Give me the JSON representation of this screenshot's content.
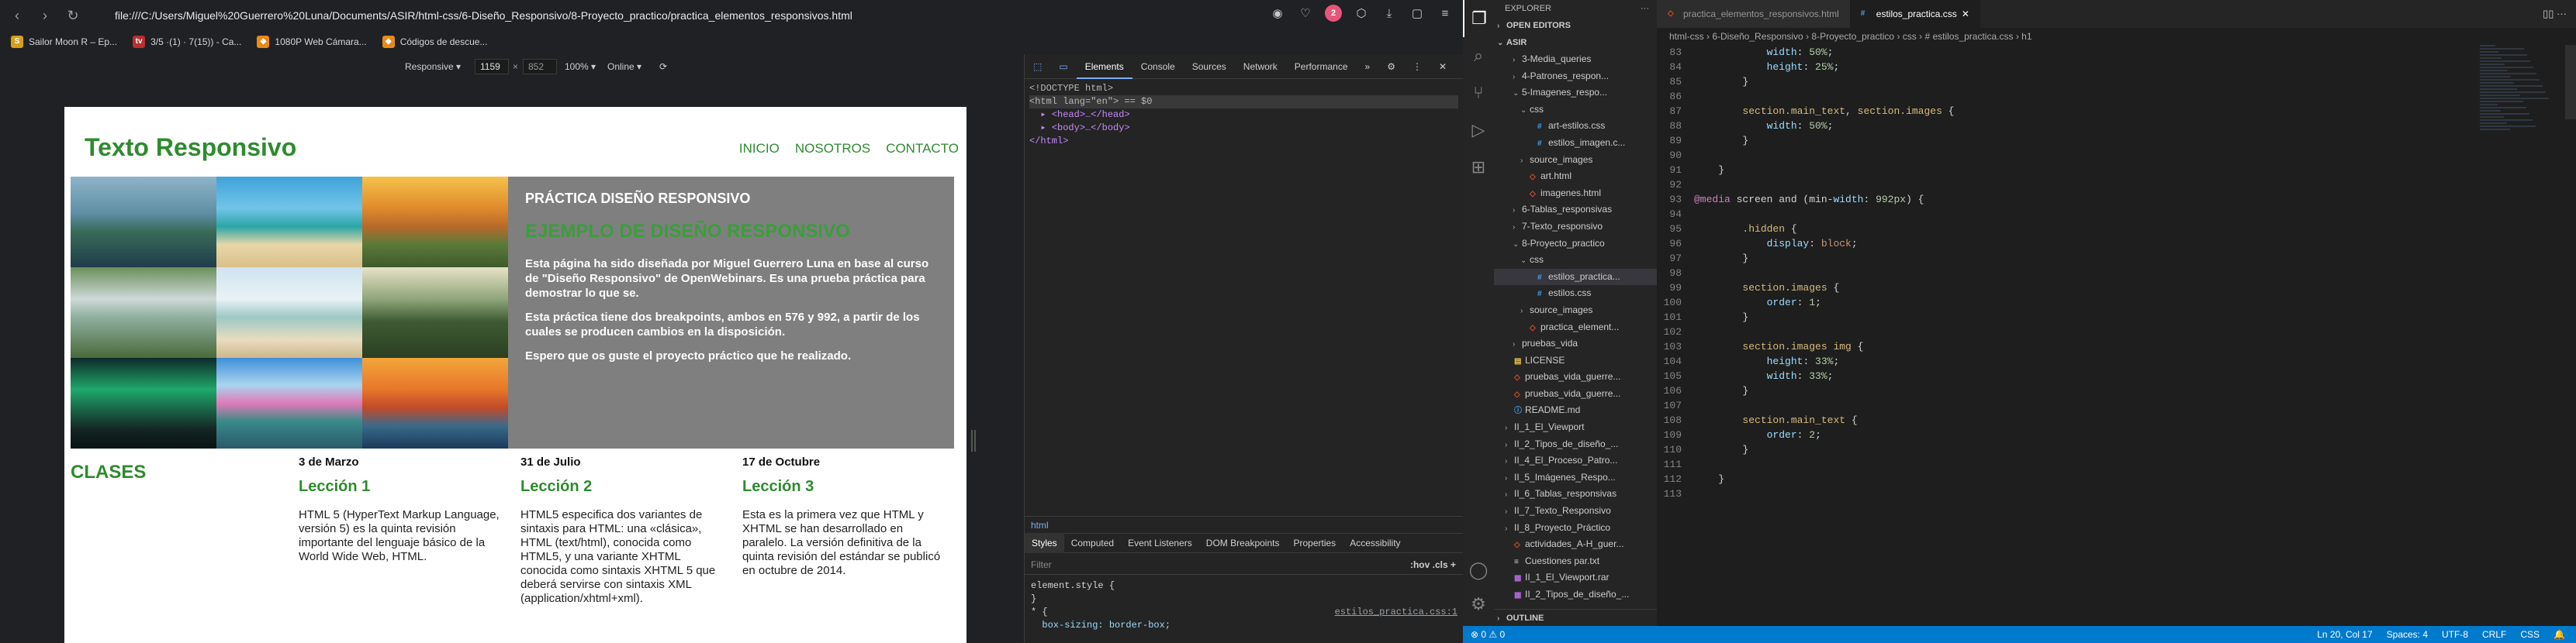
{
  "browser": {
    "url": "file:///C:/Users/Miguel%20Guerrero%20Luna/Documents/ASIR/html-css/6-Diseño_Responsivo/8-Proyecto_practico/practica_elementos_responsivos.html",
    "bookmarks": [
      {
        "label": "Sailor Moon R – Ep...",
        "color": "#d4a017",
        "icon": "S"
      },
      {
        "label": "3/5 ·(1) · 7(15)) - Ca...",
        "color": "#b83030",
        "icon": "tv"
      },
      {
        "label": "1080P Web Cámara...",
        "color": "#e88a1a",
        "icon": "◆"
      },
      {
        "label": "Códigos de descue...",
        "color": "#e88a1a",
        "icon": "◆"
      }
    ],
    "profile_badge": "2",
    "device_toolbar": {
      "device": "Responsive ▾",
      "width": "1159",
      "times": "×",
      "height": "852",
      "zoom": "100% ▾",
      "throttle": "Online ▾"
    }
  },
  "site": {
    "title": "Texto Responsivo",
    "nav": [
      "INICIO",
      "NOSOTROS",
      "CONTACTO"
    ],
    "main_heading": "PRÁCTICA DISEÑO RESPONSIVO",
    "subheading": "EJEMPLO DE DISEÑO RESPONSIVO",
    "paragraphs": [
      "Esta página ha sido diseñada por Miguel Guerrero Luna en base al curso de \"Diseño Responsivo\" de OpenWebinars. Es una prueba práctica para demostrar lo que se.",
      "Esta práctica tiene dos breakpoints, ambos en 576 y 992, a partir de los cuales se producen cambios en la disposición.",
      "Espero que os guste el proyecto práctico que he realizado."
    ],
    "classes_title": "CLASES",
    "classes": [
      {
        "date": "3 de Marzo",
        "title": "Lección 1",
        "text": "HTML 5 (HyperText Markup Language, versión 5) es la quinta revisión importante del lenguaje básico de la World Wide Web, HTML."
      },
      {
        "date": "31 de Julio",
        "title": "Lección 2",
        "text": "HTML5 especifica dos variantes de sintaxis para HTML: una «clásica», HTML (text/html), conocida como HTML5, y una variante XHTML conocida como sintaxis XHTML 5 que deberá servirse con sintaxis XML (application/xhtml+xml)."
      },
      {
        "date": "17 de Octubre",
        "title": "Lección 3",
        "text": "Esta es la primera vez que HTML y XHTML se han desarrollado en paralelo. La versión definitiva de la quinta revisión del estándar se publicó en octubre de 2014."
      }
    ]
  },
  "devtools": {
    "tabs": [
      "Elements",
      "Console",
      "Sources",
      "Network",
      "Performance",
      "»"
    ],
    "dom": [
      "<!DOCTYPE html>",
      "<html lang=\"en\"> == $0",
      "  ▸ <head>…</head>",
      "  ▸ <body>…</body>",
      "</html>"
    ],
    "breadcrumb": "html",
    "styles_tabs": [
      "Styles",
      "Computed",
      "Event Listeners",
      "DOM Breakpoints",
      "Properties",
      "Accessibility"
    ],
    "filter_placeholder": "Filter",
    "filter_actions": ":hov  .cls  +",
    "styles_lines": [
      "element.style {",
      "}",
      "* {",
      "  box-sizing: border-box;"
    ],
    "styles_source": "estilos_practica.css:1"
  },
  "vscode": {
    "explorer_title": "EXPLORER",
    "open_editors": "OPEN EDITORS",
    "root": "ASIR",
    "tree": [
      {
        "name": "3-Media_queries",
        "type": "folder",
        "depth": 2,
        "open": false
      },
      {
        "name": "4-Patrones_respon...",
        "type": "folder",
        "depth": 2,
        "open": false
      },
      {
        "name": "5-Imagenes_respo...",
        "type": "folder",
        "depth": 2,
        "open": true
      },
      {
        "name": "css",
        "type": "folder",
        "depth": 3,
        "open": true
      },
      {
        "name": "art-estilos.css",
        "type": "css",
        "depth": 4
      },
      {
        "name": "estilos_imagen.c...",
        "type": "css",
        "depth": 4
      },
      {
        "name": "source_images",
        "type": "folder",
        "depth": 3,
        "open": false
      },
      {
        "name": "art.html",
        "type": "html",
        "depth": 3
      },
      {
        "name": "imagenes.html",
        "type": "html",
        "depth": 3
      },
      {
        "name": "6-Tablas_responsivas",
        "type": "folder",
        "depth": 2,
        "open": false
      },
      {
        "name": "7-Texto_responsivo",
        "type": "folder",
        "depth": 2,
        "open": false
      },
      {
        "name": "8-Proyecto_practico",
        "type": "folder",
        "depth": 2,
        "open": true
      },
      {
        "name": "css",
        "type": "folder",
        "depth": 3,
        "open": true
      },
      {
        "name": "estilos_practica...",
        "type": "css",
        "depth": 4,
        "selected": true
      },
      {
        "name": "estilos.css",
        "type": "css",
        "depth": 4
      },
      {
        "name": "source_images",
        "type": "folder",
        "depth": 3,
        "open": false
      },
      {
        "name": "practica_element...",
        "type": "html",
        "depth": 3
      },
      {
        "name": "pruebas_vida",
        "type": "folder",
        "depth": 2,
        "open": false
      },
      {
        "name": "LICENSE",
        "type": "lic",
        "depth": 1
      },
      {
        "name": "pruebas_vida_guerre...",
        "type": "html",
        "depth": 1
      },
      {
        "name": "pruebas_vida_guerre...",
        "type": "html",
        "depth": 1
      },
      {
        "name": "README.md",
        "type": "md",
        "depth": 1
      },
      {
        "name": "II_1_El_Viewport",
        "type": "folder",
        "depth": 1,
        "open": false
      },
      {
        "name": "II_2_Tipos_de_diseño_...",
        "type": "folder",
        "depth": 1,
        "open": false
      },
      {
        "name": "II_4_El_Proceso_Patro...",
        "type": "folder",
        "depth": 1,
        "open": false
      },
      {
        "name": "II_5_Imágenes_Respo...",
        "type": "folder",
        "depth": 1,
        "open": false
      },
      {
        "name": "II_6_Tablas_responsivas",
        "type": "folder",
        "depth": 1,
        "open": false
      },
      {
        "name": "II_7_Texto_Responsivo",
        "type": "folder",
        "depth": 1,
        "open": false
      },
      {
        "name": "II_8_Proyecto_Práctico",
        "type": "folder",
        "depth": 1,
        "open": false
      },
      {
        "name": "actividades_A-H_guer...",
        "type": "html",
        "depth": 1
      },
      {
        "name": "Cuestiones par.txt",
        "type": "txt",
        "depth": 1
      },
      {
        "name": "II_1_El_Viewport.rar",
        "type": "rar",
        "depth": 1
      },
      {
        "name": "II_2_Tipos_de_diseño_...",
        "type": "rar",
        "depth": 1
      }
    ],
    "outline": "OUTLINE",
    "tabs": [
      {
        "label": "practica_elementos_responsivos.html",
        "active": false,
        "icon": "html"
      },
      {
        "label": "estilos_practica.css",
        "active": true,
        "icon": "css"
      }
    ],
    "breadcrumbs": "html-css  ›  6-Diseño_Responsivo  ›  8-Proyecto_practico  ›  css  ›  # estilos_practica.css  ›  h1",
    "code_lines": [
      {
        "n": "83",
        "t": "            width: 50%;"
      },
      {
        "n": "84",
        "t": "            height: 25%;"
      },
      {
        "n": "85",
        "t": "        }"
      },
      {
        "n": "86",
        "t": ""
      },
      {
        "n": "87",
        "t": "        section.main_text, section.images {"
      },
      {
        "n": "88",
        "t": "            width: 50%;"
      },
      {
        "n": "89",
        "t": "        }"
      },
      {
        "n": "90",
        "t": ""
      },
      {
        "n": "91",
        "t": "    }"
      },
      {
        "n": "92",
        "t": ""
      },
      {
        "n": "93",
        "t": "@media screen and (min-width: 992px) {"
      },
      {
        "n": "94",
        "t": ""
      },
      {
        "n": "95",
        "t": "        .hidden {"
      },
      {
        "n": "96",
        "t": "            display: block;"
      },
      {
        "n": "97",
        "t": "        }"
      },
      {
        "n": "98",
        "t": ""
      },
      {
        "n": "99",
        "t": "        section.images {"
      },
      {
        "n": "100",
        "t": "            order: 1;"
      },
      {
        "n": "101",
        "t": "        }"
      },
      {
        "n": "102",
        "t": ""
      },
      {
        "n": "103",
        "t": "        section.images img {"
      },
      {
        "n": "104",
        "t": "            height: 33%;"
      },
      {
        "n": "105",
        "t": "            width: 33%;"
      },
      {
        "n": "106",
        "t": "        }"
      },
      {
        "n": "107",
        "t": ""
      },
      {
        "n": "108",
        "t": "        section.main_text {"
      },
      {
        "n": "109",
        "t": "            order: 2;"
      },
      {
        "n": "110",
        "t": "        }"
      },
      {
        "n": "111",
        "t": ""
      },
      {
        "n": "112",
        "t": "    }"
      },
      {
        "n": "113",
        "t": ""
      }
    ],
    "status_left": "⊗ 0  ⚠ 0",
    "status_right": [
      "Ln 20, Col 17",
      "Spaces: 4",
      "UTF-8",
      "CRLF",
      "CSS",
      "🔔"
    ]
  },
  "colors": {
    "site_green": "#2e8b2e",
    "main_text_bg": "#7f7f7f",
    "statusbar": "#007acc"
  }
}
